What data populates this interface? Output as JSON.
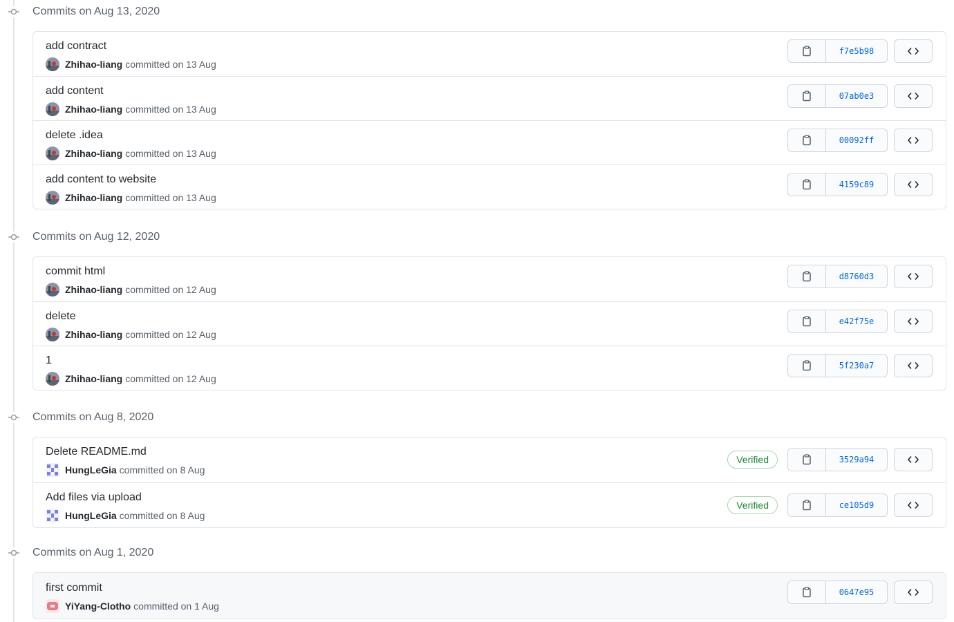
{
  "groups": [
    {
      "title": "Commits on Aug 13, 2020",
      "commits": [
        {
          "message": "add contract",
          "author": "Zhihao-liang",
          "committed": "committed on 13 Aug",
          "sha": "f7e5b98",
          "verified": false
        },
        {
          "message": "add content",
          "author": "Zhihao-liang",
          "committed": "committed on 13 Aug",
          "sha": "07ab0e3",
          "verified": false
        },
        {
          "message": "delete .idea",
          "author": "Zhihao-liang",
          "committed": "committed on 13 Aug",
          "sha": "00092ff",
          "verified": false
        },
        {
          "message": "add content to website",
          "author": "Zhihao-liang",
          "committed": "committed on 13 Aug",
          "sha": "4159c89",
          "verified": false
        }
      ]
    },
    {
      "title": "Commits on Aug 12, 2020",
      "commits": [
        {
          "message": "commit html",
          "author": "Zhihao-liang",
          "committed": "committed on 12 Aug",
          "sha": "d8760d3",
          "verified": false
        },
        {
          "message": "delete",
          "author": "Zhihao-liang",
          "committed": "committed on 12 Aug",
          "sha": "e42f75e",
          "verified": false
        },
        {
          "message": "1",
          "author": "Zhihao-liang",
          "committed": "committed on 12 Aug",
          "sha": "5f230a7",
          "verified": false
        }
      ]
    },
    {
      "title": "Commits on Aug 8, 2020",
      "commits": [
        {
          "message": "Delete README.md",
          "author": "HungLeGia",
          "committed": "committed on 8 Aug",
          "sha": "3529a94",
          "verified": true
        },
        {
          "message": "Add files via upload",
          "author": "HungLeGia",
          "committed": "committed on 8 Aug",
          "sha": "ce105d9",
          "verified": true
        }
      ]
    },
    {
      "title": "Commits on Aug 1, 2020",
      "commits": [
        {
          "message": "first commit",
          "author": "YiYang-Clotho",
          "committed": "committed on 1 Aug",
          "sha": "0647e95",
          "verified": false
        }
      ]
    }
  ],
  "verified_label": "Verified",
  "icons": {
    "commit": "git-commit-icon",
    "copy": "clipboard-icon",
    "browse": "code-icon"
  },
  "colors": {
    "sha_link": "#0366d6",
    "verified_green": "#22863a",
    "border": "#e1e4e8",
    "muted_text": "#586069"
  }
}
